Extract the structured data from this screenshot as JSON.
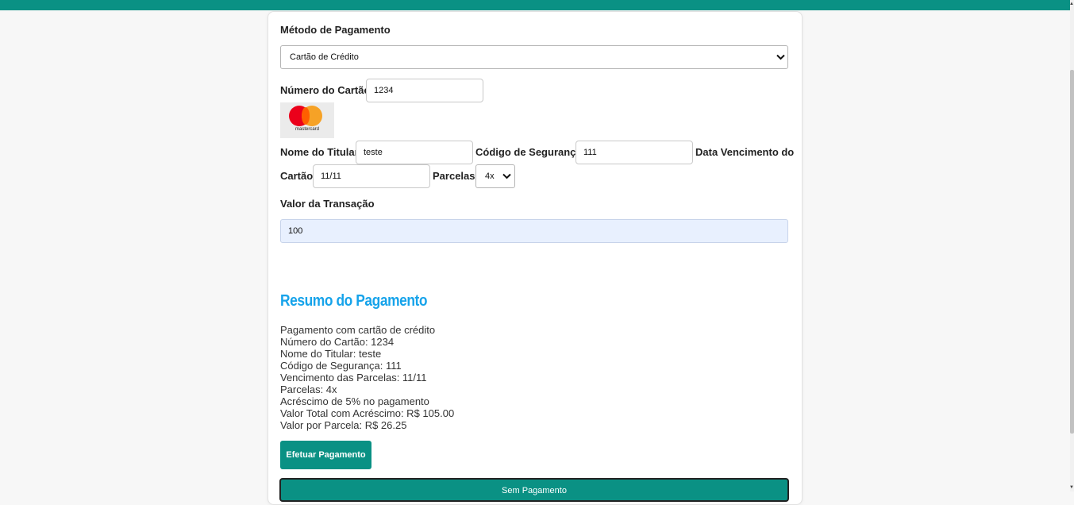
{
  "form": {
    "payment_method_label": "Método de Pagamento",
    "payment_method_value": "Cartão de Crédito",
    "card_number_label": "Número do Cartão",
    "card_number_value": "1234",
    "card_brand_icon": "mastercard-logo",
    "card_brand_text": "mastercard",
    "holder_label": "Nome do Titular",
    "holder_value": "teste",
    "cvv_label": "Código de Segurança",
    "cvv_value": "111",
    "expiry_label_line1": "Data Vencimento do",
    "expiry_label_line2": "Cartão",
    "expiry_value": "11/11",
    "installments_label": "Parcelas",
    "installments_value": "4x",
    "amount_label": "Valor da Transação",
    "amount_value": "100"
  },
  "summary": {
    "title": "Resumo do Pagamento",
    "lines": [
      "Pagamento com cartão de crédito",
      "Número do Cartão: 1234",
      "Nome do Titular: teste",
      "Código de Segurança: 111",
      "Vencimento das Parcelas: 11/11",
      "Parcelas: 4x",
      "Acréscimo de 5% no pagamento",
      "Valor Total com Acréscimo: R$ 105.00",
      "Valor por Parcela: R$ 26.25"
    ]
  },
  "actions": {
    "pay_button": "Efetuar Pagamento",
    "save_button": "Sem Pagamento"
  },
  "colors": {
    "accent": "#0a9184",
    "title": "#16a3ea",
    "autofill_bg": "#e8f0fe"
  }
}
